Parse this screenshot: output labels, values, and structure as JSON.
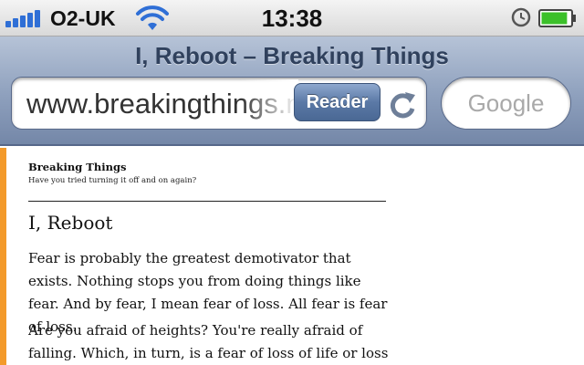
{
  "status_bar": {
    "carrier": "O2-UK",
    "time": "13:38",
    "signal_bars": 5,
    "battery_level": 0.9,
    "colors": {
      "signal": "#2f6fd6",
      "battery": "#3cc02a"
    }
  },
  "browser": {
    "page_title": "I, Reboot – Breaking Things",
    "url": "www.breakingthings.net",
    "reader_label": "Reader",
    "search_placeholder": "Google"
  },
  "page": {
    "site_name": "Breaking Things",
    "tagline": "Have you tried turning it off and on again?",
    "post_title": "I, Reboot",
    "paragraphs": [
      "Fear is probably the greatest demotivator that exists. Nothing stops you from doing things like fear. And by fear, I mean fear of loss. All fear is fear of loss.",
      "Are you afraid of heights? You're really afraid of falling. Which, in turn, is a fear of loss of life or loss"
    ],
    "accent_color": "#f39a2b"
  }
}
